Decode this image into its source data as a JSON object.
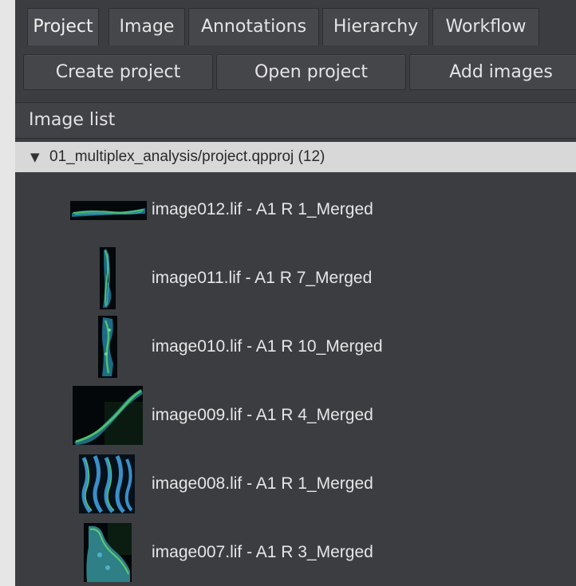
{
  "tabs": [
    {
      "label": "Project",
      "active": true
    },
    {
      "label": "Image",
      "active": false
    },
    {
      "label": "Annotations",
      "active": false
    },
    {
      "label": "Hierarchy",
      "active": false
    },
    {
      "label": "Workflow",
      "active": false
    }
  ],
  "toolbar": {
    "create_project": "Create project",
    "open_project": "Open project",
    "add_images": "Add images"
  },
  "image_list": {
    "title": "Image list",
    "project": {
      "label": "01_multiplex_analysis/project.qpproj (12)",
      "expanded": true
    },
    "items": [
      {
        "label": "image012.lif - A1 R 1_Merged"
      },
      {
        "label": "image011.lif - A1 R 7_Merged"
      },
      {
        "label": "image010.lif - A1 R 10_Merged"
      },
      {
        "label": "image009.lif - A1 R 4_Merged"
      },
      {
        "label": "image008.lif - A1 R 1_Merged"
      },
      {
        "label": "image007.lif - A1 R 3_Merged"
      }
    ]
  },
  "colors": {
    "panel_bg": "#3b3d41",
    "selected_row_bg": "#d8d8d8",
    "thumb_green": "#3ea85a",
    "thumb_cyan": "#3aa0b8"
  },
  "icons": {
    "expand": "triangle-down-icon"
  }
}
